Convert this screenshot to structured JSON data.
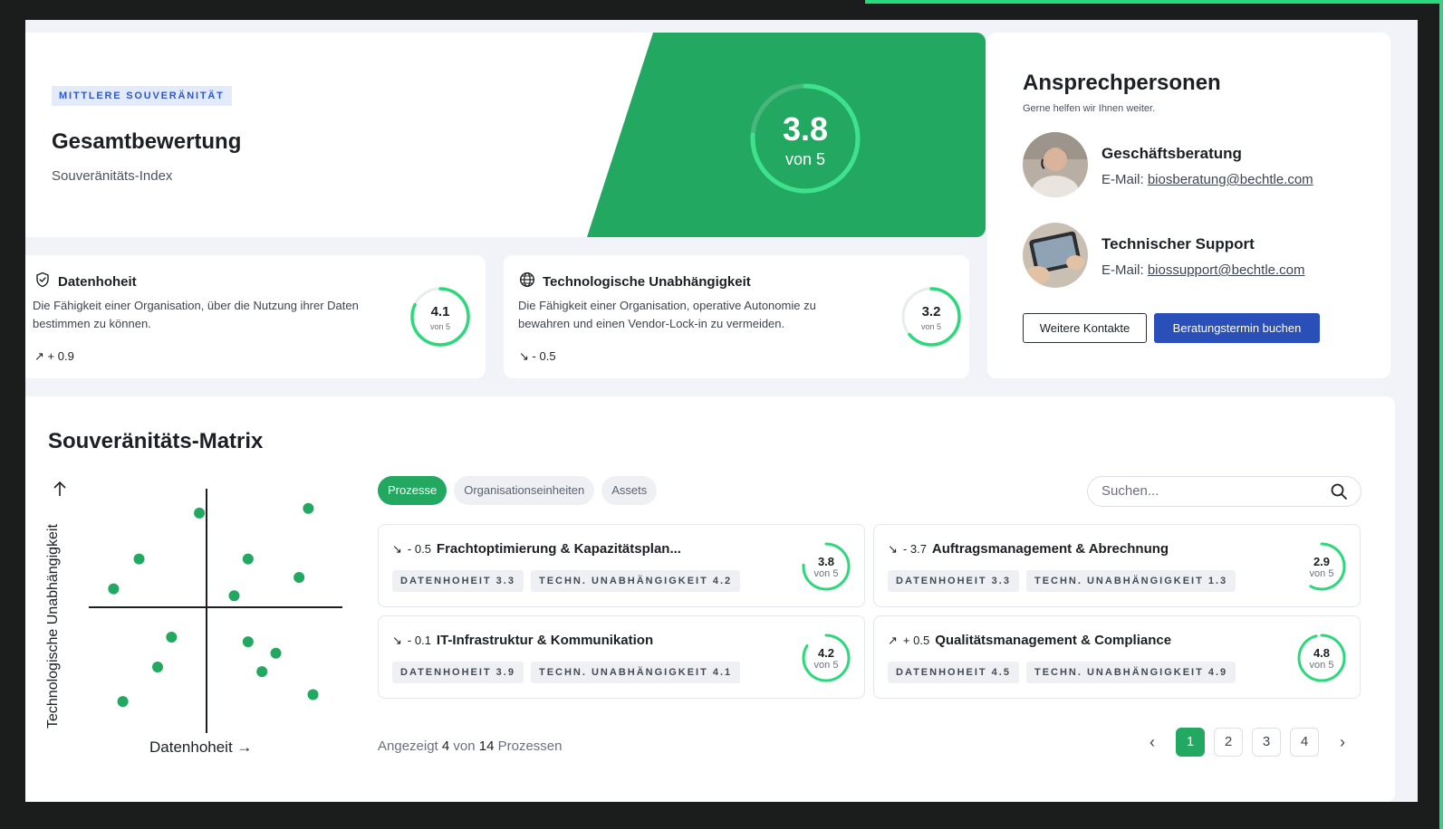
{
  "hero": {
    "badge": "MITTLERE SOUVERÄNITÄT",
    "title": "Gesamtbewertung",
    "subtitle": "Souveränitäts-Index",
    "score": "3.8",
    "score_of": "von 5",
    "score_fraction": 0.76
  },
  "metrics": [
    {
      "icon": "shield-check-icon",
      "title": "Datenhoheit",
      "description": "Die Fähigkeit einer Organisation, über die Nutzung ihrer Daten bestimmen zu können.",
      "trend_icon": "trend-up-icon",
      "trend": "+ 0.9",
      "score": "4.1",
      "score_of": "von 5",
      "score_fraction": 0.82
    },
    {
      "icon": "globe-icon",
      "title": "Technologische Unabhängigkeit",
      "description": "Die Fähigkeit einer Organisation, operative Autonomie zu bewahren und einen Vendor-Lock-in zu vermeiden.",
      "trend_icon": "trend-down-icon",
      "trend": "- 0.5",
      "score": "3.2",
      "score_of": "von 5",
      "score_fraction": 0.64
    }
  ],
  "contacts": {
    "title": "Ansprechpersonen",
    "subtitle": "Gerne helfen wir Ihnen weiter.",
    "people": [
      {
        "name": "Geschäftsberatung",
        "mail_label": "E-Mail:",
        "mail": "biosberatung@bechtle.com"
      },
      {
        "name": "Technischer Support",
        "mail_label": "E-Mail:",
        "mail": "biossupport@bechtle.com"
      }
    ],
    "more_button": "Weitere Kontakte",
    "book_button": "Beratungstermin buchen"
  },
  "matrix": {
    "title": "Souveränitäts-Matrix",
    "y_label": "Technologische Unabhängigkeit",
    "x_label": "Datenhoheit",
    "tabs": [
      "Prozesse",
      "Organisationseinheiten",
      "Assets"
    ],
    "active_tab": "Prozesse",
    "search_placeholder": "Suchen...",
    "footer": {
      "prefix": "Angezeigt",
      "shown": "4",
      "middle": "von",
      "total": "14",
      "suffix": "Prozessen"
    },
    "pages": [
      "1",
      "2",
      "3",
      "4"
    ],
    "active_page": "1",
    "processes": [
      {
        "trend_icon": "trend-down-icon",
        "delta": "- 0.5",
        "title": "Frachtoptimierung & Kapazitätsplan...",
        "tag1": "DATENHOHEIT 3.3",
        "tag2": "TECHN. UNABHÄNGIGKEIT 4.2",
        "score": "3.8",
        "score_of": "von 5",
        "score_fraction": 0.76
      },
      {
        "trend_icon": "trend-down-icon",
        "delta": "- 3.7",
        "title": "Auftragsmanagement & Abrechnung",
        "tag1": "DATENHOHEIT 3.3",
        "tag2": "TECHN. UNABHÄNGIGKEIT 1.3",
        "score": "2.9",
        "score_of": "von 5",
        "score_fraction": 0.58
      },
      {
        "trend_icon": "trend-down-icon",
        "delta": "- 0.1",
        "title": "IT-Infrastruktur & Kommunikation",
        "tag1": "DATENHOHEIT 3.9",
        "tag2": "TECHN. UNABHÄNGIGKEIT 4.1",
        "score": "4.2",
        "score_of": "von 5",
        "score_fraction": 0.84
      },
      {
        "trend_icon": "trend-up-icon",
        "delta": "+ 0.5",
        "title": "Qualitätsmanagement & Compliance",
        "tag1": "DATENHOHEIT 4.5",
        "tag2": "TECHN. UNABHÄNGIGKEIT 4.9",
        "score": "4.8",
        "score_of": "von 5",
        "score_fraction": 0.96
      }
    ]
  },
  "chart_data": {
    "type": "scatter",
    "xlabel": "Datenhoheit",
    "ylabel": "Technologische Unabhängigkeit",
    "xlim": [
      0,
      10
    ],
    "ylim": [
      0,
      10
    ],
    "quadrant_center": [
      5,
      5
    ],
    "points": [
      {
        "x": 4.3,
        "y": 9.1
      },
      {
        "x": 9.0,
        "y": 9.3
      },
      {
        "x": 1.7,
        "y": 7.1
      },
      {
        "x": 6.4,
        "y": 7.1
      },
      {
        "x": 0.6,
        "y": 5.8
      },
      {
        "x": 5.8,
        "y": 5.5
      },
      {
        "x": 8.6,
        "y": 6.3
      },
      {
        "x": 3.1,
        "y": 3.7
      },
      {
        "x": 6.4,
        "y": 3.5
      },
      {
        "x": 7.6,
        "y": 3.0
      },
      {
        "x": 2.5,
        "y": 2.4
      },
      {
        "x": 7.0,
        "y": 2.2
      },
      {
        "x": 9.2,
        "y": 1.2
      },
      {
        "x": 1.0,
        "y": 0.9
      }
    ],
    "point_color": "#22a861",
    "axis_color": "#1c1f24"
  },
  "colors": {
    "accent": "#22a861",
    "primary_button": "#2a4fb8",
    "badge": "#2f58c8"
  }
}
